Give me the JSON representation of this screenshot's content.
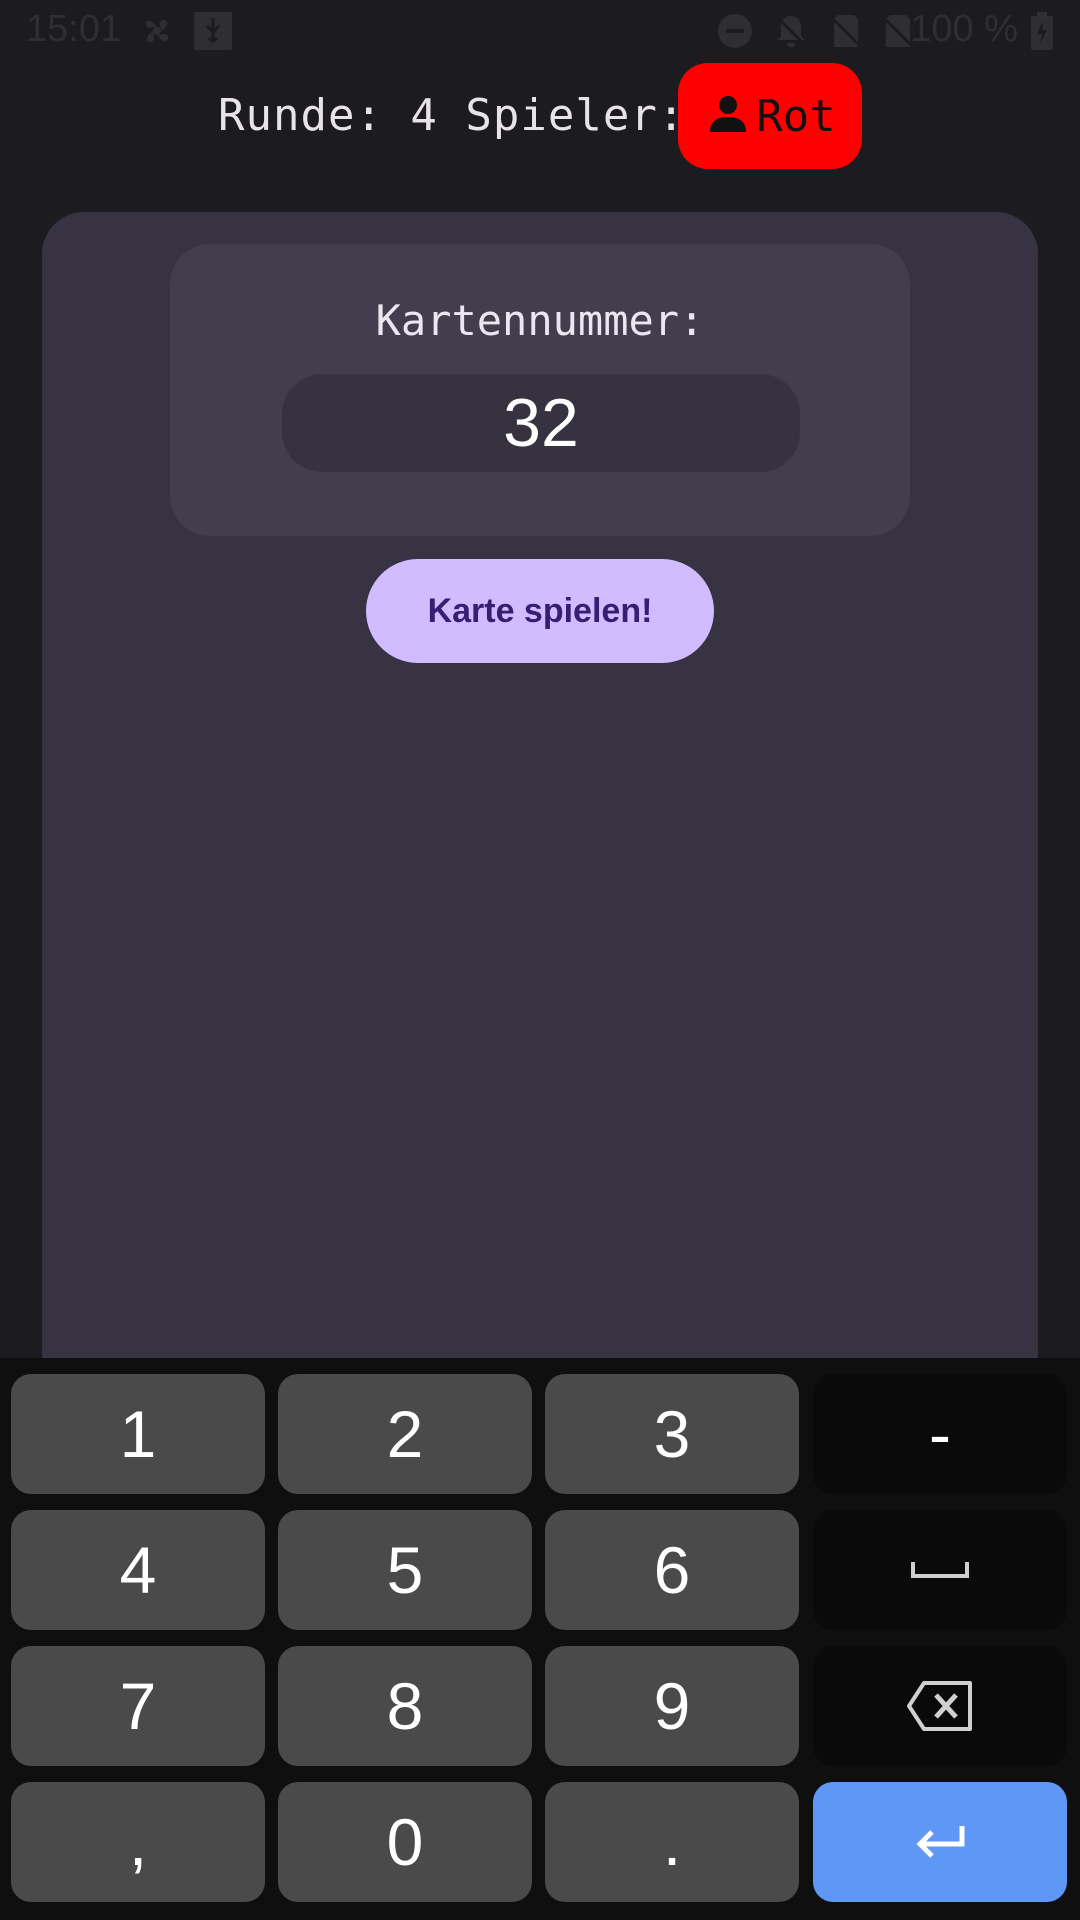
{
  "status_bar": {
    "time": "15:01",
    "battery": "100 %",
    "icons": [
      "fan-icon",
      "usb-debug-icon",
      "do-not-disturb-icon",
      "notifications-off-icon",
      "no-sim-icon",
      "no-sim-icon",
      "battery-charging-icon"
    ]
  },
  "header": {
    "round_label": "Runde: 4 Spieler:",
    "player_name": "Rot",
    "player_icon": "person-icon",
    "player_color": "#ff0000"
  },
  "card": {
    "label": "Kartennummer:",
    "value": "32"
  },
  "play_button": {
    "label": "Karte spielen!"
  },
  "keyboard": {
    "keys": [
      {
        "label": "1",
        "name": "key-1"
      },
      {
        "label": "2",
        "name": "key-2"
      },
      {
        "label": "3",
        "name": "key-3"
      },
      {
        "label": "-",
        "name": "key-minus"
      },
      {
        "label": "4",
        "name": "key-4"
      },
      {
        "label": "5",
        "name": "key-5"
      },
      {
        "label": "6",
        "name": "key-6"
      },
      {
        "label": "",
        "name": "key-space",
        "icon": "space-icon"
      },
      {
        "label": "7",
        "name": "key-7"
      },
      {
        "label": "8",
        "name": "key-8"
      },
      {
        "label": "9",
        "name": "key-9"
      },
      {
        "label": "",
        "name": "key-backspace",
        "icon": "backspace-icon"
      },
      {
        "label": ",",
        "name": "key-comma"
      },
      {
        "label": "0",
        "name": "key-0"
      },
      {
        "label": ".",
        "name": "key-period"
      },
      {
        "label": "",
        "name": "key-enter",
        "icon": "enter-icon"
      }
    ]
  },
  "colors": {
    "background": "#1c1b20",
    "panel": "#373342",
    "button": "#d0bcff",
    "enter_key": "#5e97f6"
  }
}
